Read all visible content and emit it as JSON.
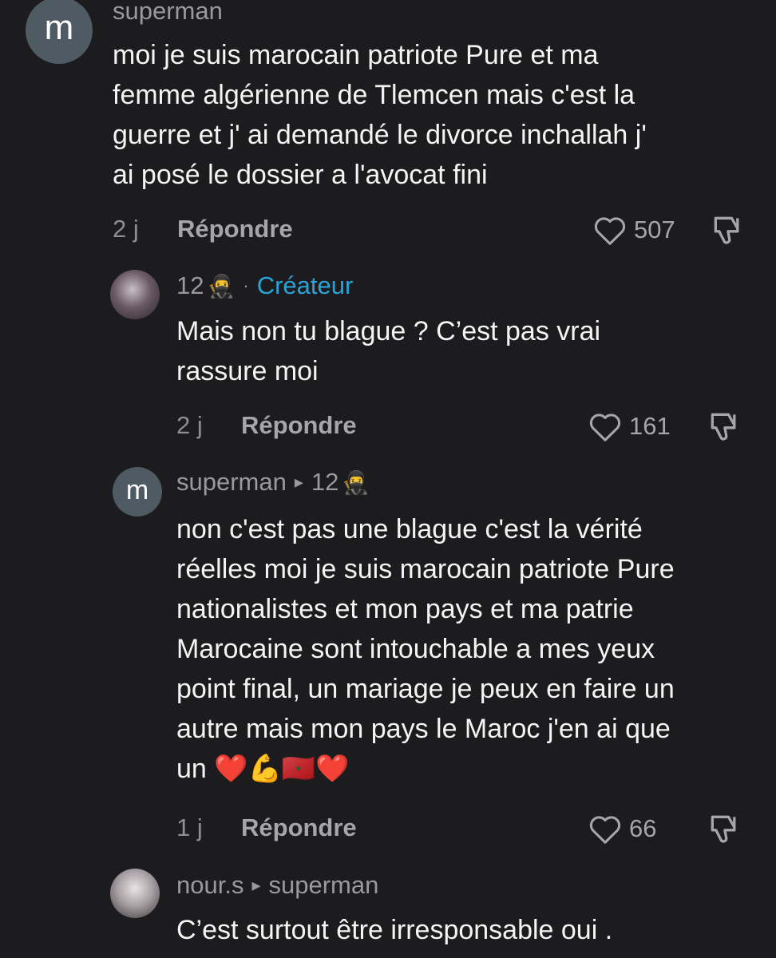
{
  "comments": [
    {
      "username": "superman",
      "avatar_letter": "m",
      "text": "moi je suis marocain patriote Pure et ma\nfemme algérienne de Tlemcen mais c'est la\nguerre et j' ai demandé le divorce inchallah j'\nai posé le dossier a l'avocat fini",
      "time": "2 j",
      "reply_label": "Répondre",
      "likes": "507"
    },
    {
      "username": "12",
      "badge": "Créateur",
      "badge_separator": "·",
      "text": "Mais non tu blague ? C’est pas vrai\nrassure moi",
      "time": "2 j",
      "reply_label": "Répondre",
      "likes": "161"
    },
    {
      "username": "superman",
      "reply_to": "12",
      "avatar_letter": "m",
      "text": "non c'est pas une blague c'est la vérité\nréelles moi je suis marocain patriote Pure\nnationalistes et mon pays et ma patrie\nMarocaine sont intouchable a mes yeux\npoint final, un mariage je peux en faire un\nautre mais mon pays le Maroc j'en ai que\nun ❤️💪🇲🇦❤️",
      "time": "1 j",
      "reply_label": "Répondre",
      "likes": "66"
    },
    {
      "username": "nour.s",
      "reply_to": "superman",
      "text": "C’est surtout être irresponsable oui ."
    }
  ],
  "colors": {
    "background": "#1c1c1e",
    "creator_badge": "#2aa4d8",
    "avatar_bg": "#4f5b62"
  },
  "icons": [
    "heart-icon",
    "dislike-icon",
    "reply-arrow-icon",
    "ninja-emoji"
  ]
}
